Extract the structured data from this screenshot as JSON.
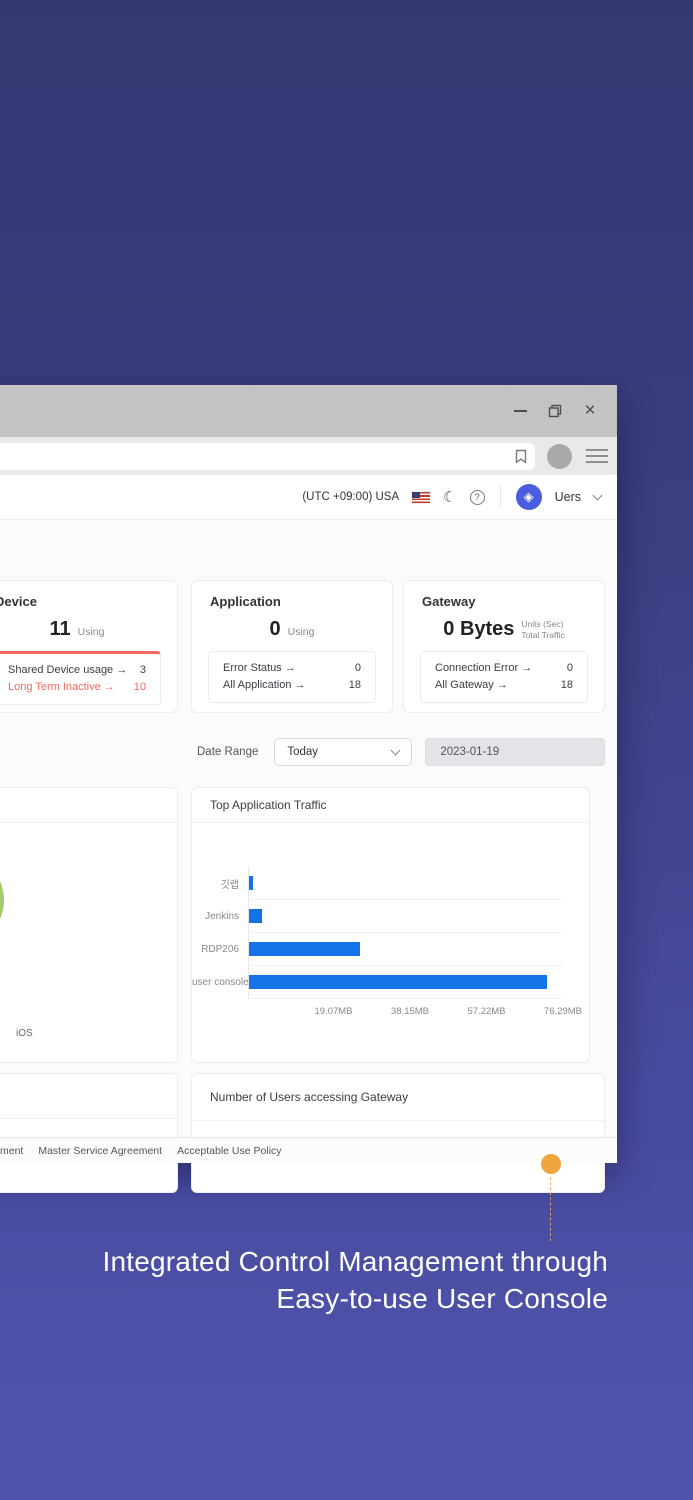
{
  "window": {
    "controls": {
      "minimize": "minimize",
      "restore": "restore",
      "close": "×"
    }
  },
  "header": {
    "timezone": "(UTC +09:00) USA",
    "user_label": "Uers",
    "help_glyph": "?",
    "moon_glyph": "☾",
    "badge_glyph": "◈"
  },
  "cards": {
    "device": {
      "title": "Device",
      "value": "11",
      "unit": "Using",
      "rows": [
        {
          "label": "Shared Device usage →",
          "value": "3"
        },
        {
          "label": "Long Term Inactive →",
          "value": "10"
        }
      ]
    },
    "application": {
      "title": "Application",
      "value": "0",
      "unit": "Using",
      "rows": [
        {
          "label": "Error Status →",
          "value": "0"
        },
        {
          "label": "All Application →",
          "value": "18"
        }
      ]
    },
    "gateway": {
      "title": "Gateway",
      "value": "0",
      "unit": "Bytes",
      "note_line1": "Units (Sec)",
      "note_line2": "Total Traffic",
      "rows": [
        {
          "label": "Connection Error →",
          "value": "0"
        },
        {
          "label": "All Gateway →",
          "value": "18"
        }
      ]
    }
  },
  "filters": {
    "date_range_label": "Date Range",
    "range_value": "Today",
    "date_value": "2023-01-19"
  },
  "chart_data": [
    {
      "type": "bar",
      "orientation": "horizontal",
      "title": "Top Application Traffic",
      "categories": [
        "깃랩",
        "Jenkins",
        "RDP206",
        "user console"
      ],
      "values": [
        1.0,
        3.2,
        26.9,
        72.5
      ],
      "unit": "MB",
      "x_ticks": [
        "19.07MB",
        "38.15MB",
        "57.22MB",
        "76.29MB"
      ],
      "xmax": 76.29,
      "xlim": [
        0,
        76.29
      ],
      "bar_color": "#1473e6",
      "grid": "row-separators",
      "legend_position": "none"
    },
    {
      "type": "donut",
      "note_partially_visible": true,
      "legend": [
        "iOS"
      ],
      "colors": [
        "#a3cb6c"
      ]
    }
  ],
  "users_card": {
    "title": "Number of Users accessing Gateway"
  },
  "footer": {
    "links": [
      "ment",
      "Master Service Agreement",
      "Acceptable Use Policy"
    ]
  },
  "caption": {
    "line1": "Integrated Control Management through",
    "line2": "Easy-to-use User Console"
  },
  "colors": {
    "accent_blue": "#1473e6",
    "donut_green": "#a3cb6c",
    "alert_red": "#f2695f",
    "badge_blue": "#4a5cdf",
    "pin_orange": "#f0a53c",
    "background_top": "#353870",
    "background_bottom": "#5054ac"
  }
}
